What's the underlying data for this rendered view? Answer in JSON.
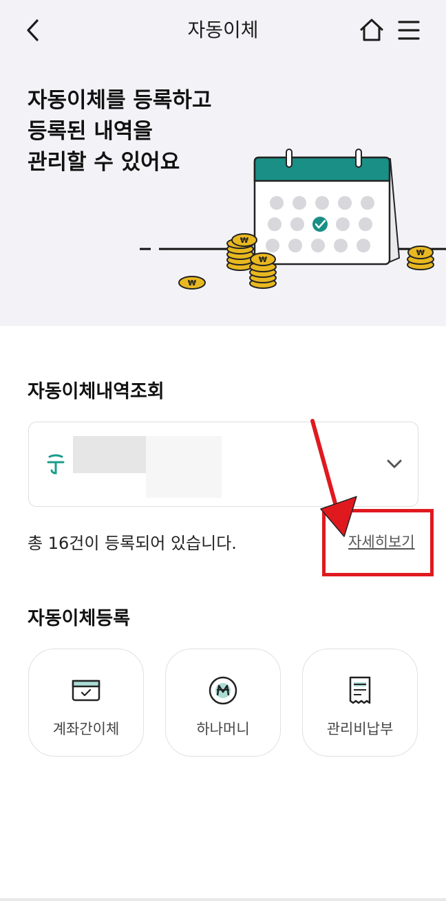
{
  "header": {
    "title": "자동이체",
    "back_icon": "chevron-left-icon",
    "home_icon": "home-icon",
    "menu_icon": "hamburger-menu-icon"
  },
  "hero": {
    "lines": [
      "자동이체를 등록하고",
      "등록된 내역을",
      "관리할 수 있어요"
    ],
    "illustration": "calendar-with-coins-illustration"
  },
  "inquiry": {
    "title": "자동이체내역조회",
    "account_selector": {
      "bank_icon": "hana-bank-logo-icon",
      "dropdown_icon": "chevron-down-icon"
    },
    "count_text": "총 16건이 등록되어 있습니다.",
    "detail_link": "자세히보기"
  },
  "registration": {
    "title": "자동이체등록",
    "items": [
      {
        "label": "계좌간이체",
        "icon": "card-check-icon"
      },
      {
        "label": "하나머니",
        "icon": "hana-money-coin-icon"
      },
      {
        "label": "관리비납부",
        "icon": "receipt-icon"
      }
    ]
  },
  "colors": {
    "hero_bg": "#f3f3f7",
    "calendar_teal": "#1a8f86",
    "coin_gold": "#e8b820",
    "annotation_red": "#e0191f"
  }
}
